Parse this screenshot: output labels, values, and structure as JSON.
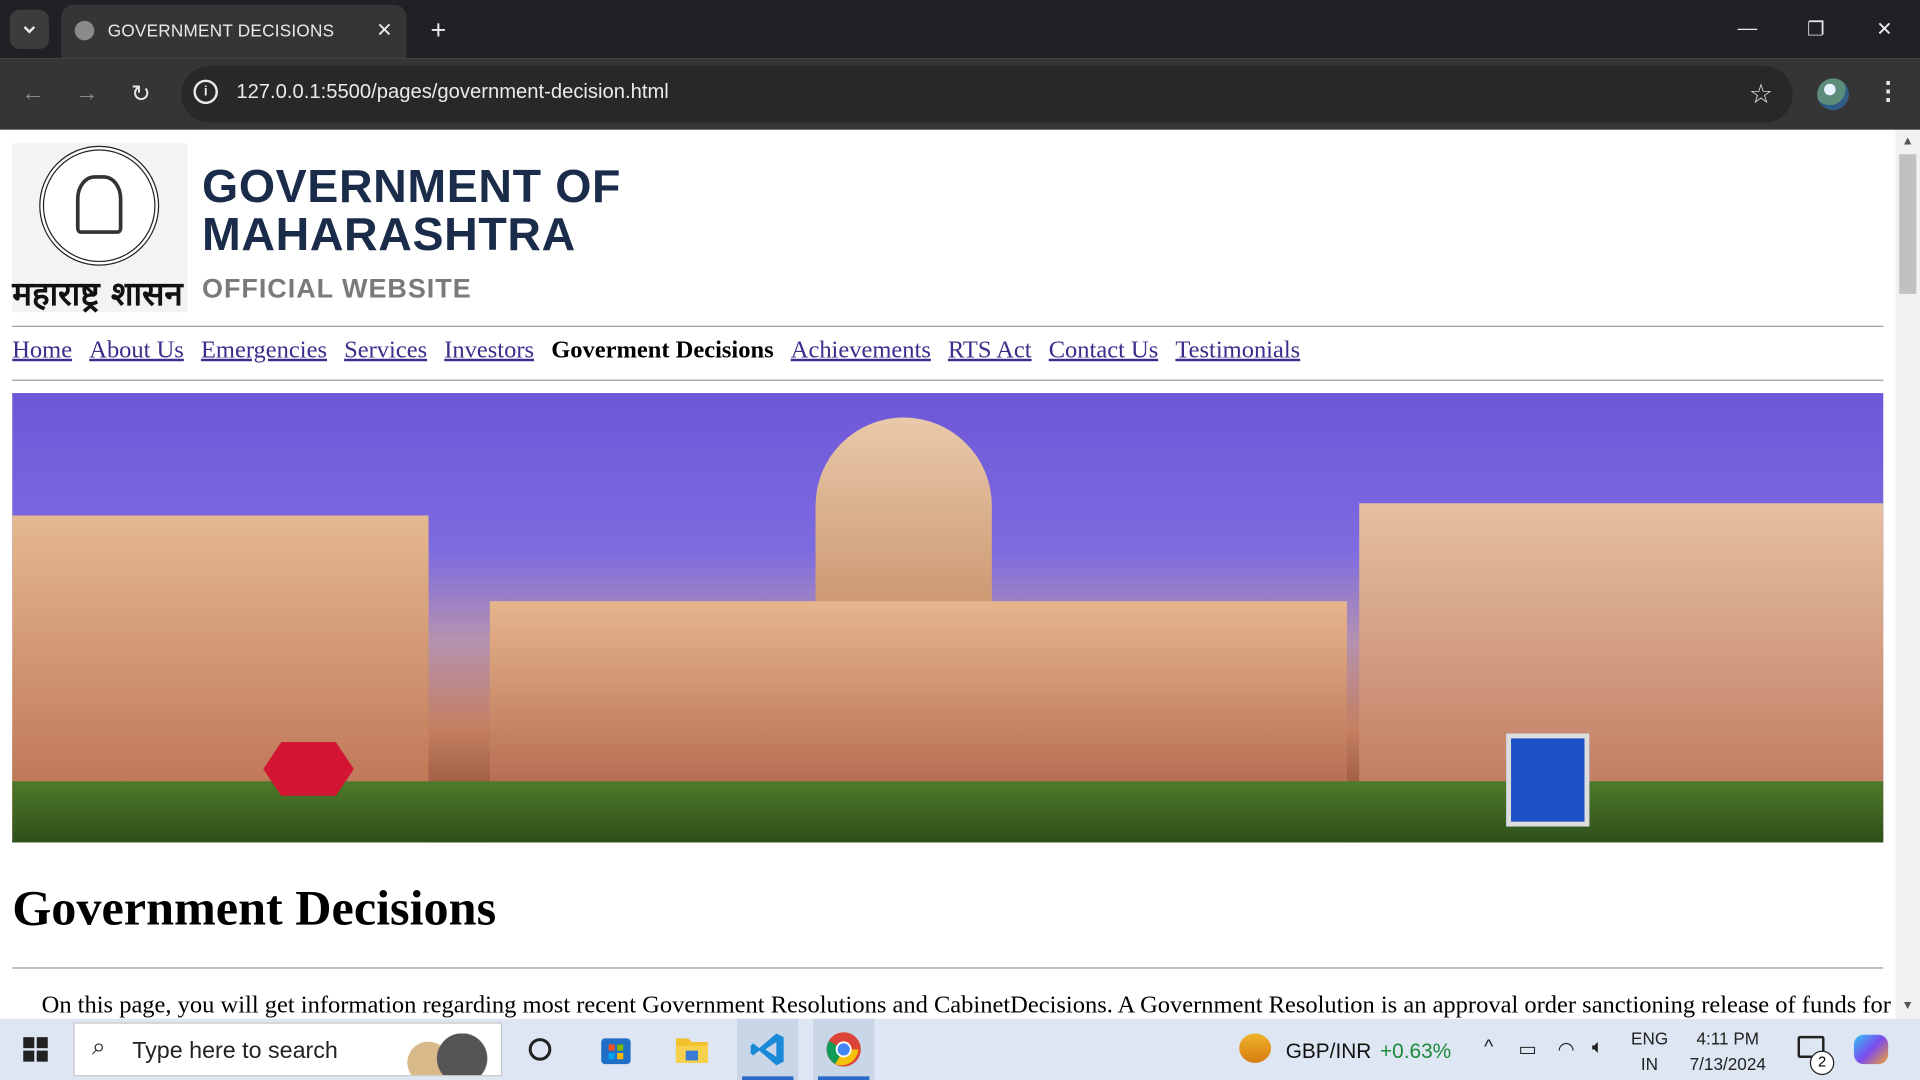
{
  "browser": {
    "tab_title": "GOVERNMENT DECISIONS",
    "url": "127.0.0.1:5500/pages/government-decision.html"
  },
  "header": {
    "logo_text": "महाराष्ट्र शासन",
    "title_line1": "GOVERNMENT OF",
    "title_line2": "MAHARASHTRA",
    "subtitle": "OFFICIAL WEBSITE"
  },
  "nav": {
    "items": [
      {
        "label": "Home"
      },
      {
        "label": "About Us"
      },
      {
        "label": "Emergencies"
      },
      {
        "label": "Services"
      },
      {
        "label": "Investors"
      },
      {
        "label": "Goverment Decisions",
        "active": true
      },
      {
        "label": "Achievements"
      },
      {
        "label": "RTS Act"
      },
      {
        "label": "Contact Us"
      },
      {
        "label": "Testimonials"
      }
    ]
  },
  "main": {
    "heading": "Government Decisions",
    "intro": "On this page, you will get information regarding most recent Government Resolutions and CabinetDecisions. A Government Resolution is an approval order sanctioning release of funds for"
  },
  "taskbar": {
    "search_placeholder": "Type here to search",
    "ticker_pair": "GBP/INR",
    "ticker_change": "+0.63%",
    "lang_line1": "ENG",
    "lang_line2": "IN",
    "time": "4:11 PM",
    "date": "7/13/2024",
    "notification_count": "2"
  },
  "colors": {
    "chrome_dark": "#202124",
    "link": "#3a2d8c",
    "title_navy": "#1a2c4a",
    "ticker_green": "#1c8a3a"
  }
}
